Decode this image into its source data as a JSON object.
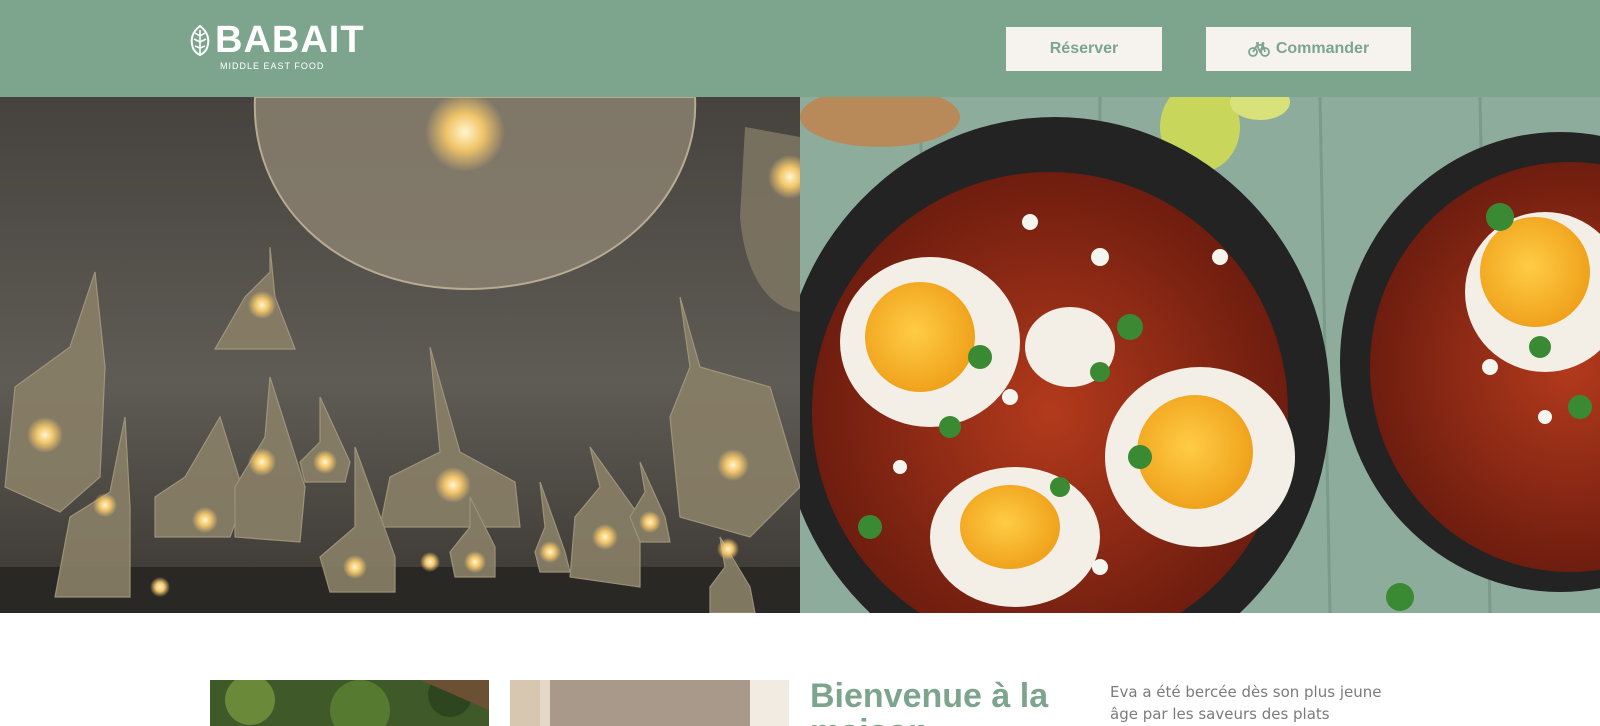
{
  "brand": {
    "name": "BABAIT",
    "tagline": "MIDDLE EAST FOOD"
  },
  "header": {
    "reserve_label": "Réserver",
    "order_label": "Commander",
    "order_icon": "bicycle-icon"
  },
  "hero": {
    "left_image": "restaurant-pendant-lamps-photo",
    "right_image": "shakshuka-skillet-photo"
  },
  "intro": {
    "title": "Bienvenue à la maison",
    "text": "Eva a été bercée dès son plus jeune âge par les saveurs des plats"
  },
  "colors": {
    "brand_green": "#7da58e",
    "button_bg": "#f6f3ee",
    "body_text": "#7b7b7b"
  }
}
